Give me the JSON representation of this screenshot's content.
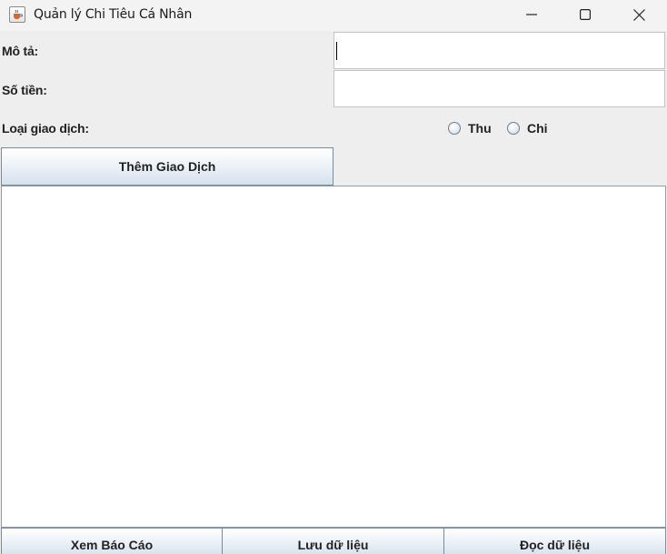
{
  "window": {
    "title": "Quản lý Chi Tiêu Cá Nhân",
    "app_icon": "java-cup-icon",
    "controls": [
      "minimize-icon",
      "maximize-icon",
      "close-icon"
    ]
  },
  "form": {
    "description_label": "Mô tả:",
    "description_value": "",
    "amount_label": "Số tiền:",
    "amount_value": "",
    "type_label": "Loại giao dịch:",
    "type_options": [
      {
        "label": "Thu",
        "selected": false
      },
      {
        "label": "Chi",
        "selected": false
      }
    ],
    "add_button": "Thêm Giao Dịch"
  },
  "transactions": [],
  "footer": {
    "report_button": "Xem Báo Cáo",
    "save_button": "Lưu dữ liệu",
    "load_button": "Đọc dữ liệu"
  },
  "colors": {
    "window_bg": "#eeeeee",
    "field_border": "#b9c5d3",
    "button_gradient_bottom": "#d6e1ec"
  }
}
